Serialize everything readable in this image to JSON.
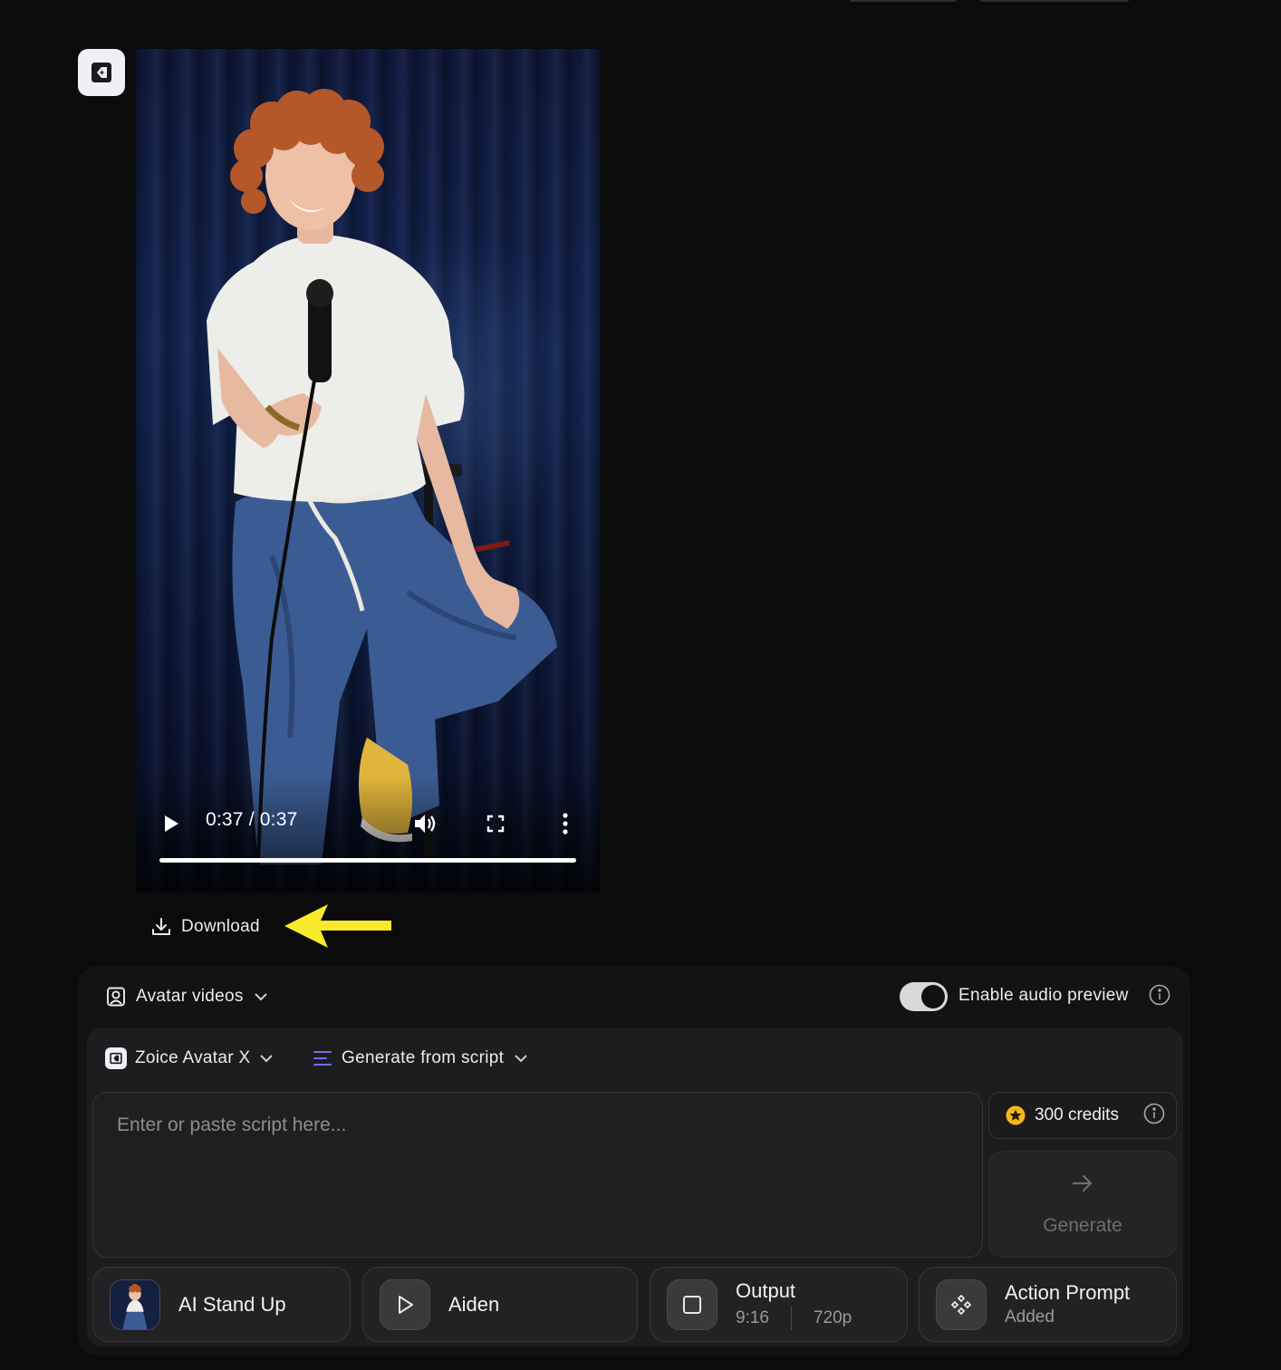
{
  "player": {
    "time_display": "0:37 / 0:37",
    "progress_fraction": 1.0
  },
  "download": {
    "label": "Download"
  },
  "annotation": {
    "arrow_color": "#f7ea2a"
  },
  "toolbar": {
    "content_type_label": "Avatar videos",
    "audio_preview_label": "Enable audio preview",
    "audio_preview_enabled": true
  },
  "composer": {
    "model_label": "Zoice Avatar X",
    "mode_label": "Generate from script",
    "script_placeholder": "Enter or paste script here...",
    "credits_label": "300 credits",
    "generate_label": "Generate"
  },
  "chips": {
    "avatar_label": "AI Stand Up",
    "voice_label": "Aiden",
    "output_title": "Output",
    "output_ratio": "9:16",
    "output_resolution": "720p",
    "action_title": "Action Prompt",
    "action_status": "Added"
  },
  "colors": {
    "background": "#0b0b0c",
    "panel": "#131314",
    "accent_indigo": "#6b6ef5",
    "credits_star": "#f5b81c"
  }
}
